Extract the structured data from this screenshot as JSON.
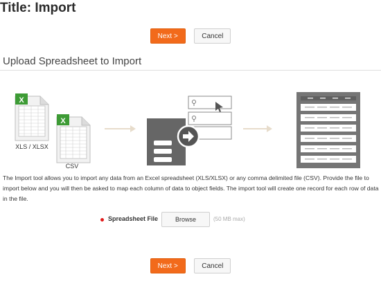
{
  "page": {
    "title": "Title: Import"
  },
  "buttons_top": {
    "next": "Next >",
    "cancel": "Cancel"
  },
  "section": {
    "title": "Upload Spreadsheet to Import"
  },
  "illustration": {
    "excel_caption": "XLS / XLSX",
    "csv_caption": "CSV",
    "excel_badge": "X",
    "csv_badge": "X",
    "arrow_icon": "arrow-right-icon",
    "cursor_icon": "cursor-icon"
  },
  "description": "The Import tool allows you to import any data from an Excel spreadsheet (XLS/XLSX) or any comma delimited file (CSV). Provide the file to import below and you will then be asked to map each column of data to object fields. The import tool will create one record for each row of data in the file.",
  "file_field": {
    "label": "Spreadsheet File",
    "browse": "Browse",
    "hint": "(50 MB max)",
    "required": true
  },
  "buttons_bottom": {
    "next": "Next >",
    "cancel": "Cancel"
  },
  "colors": {
    "primary": "#f26a1b",
    "required": "#e21b1b",
    "excel_green": "#3d9b35",
    "illustration_gray": "#666666"
  }
}
